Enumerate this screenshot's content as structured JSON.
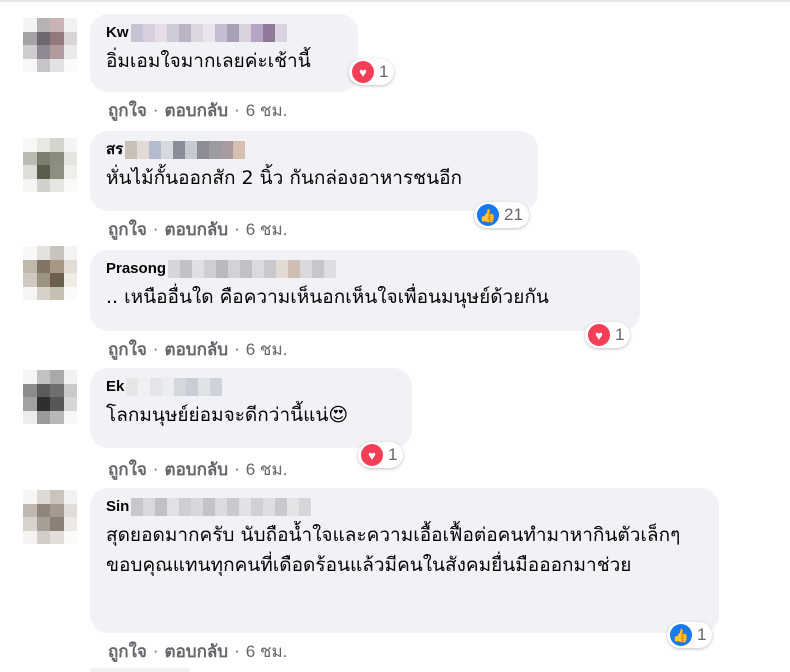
{
  "comments": [
    {
      "name": "Kw",
      "text": "อิ่มเอมใจมากเลยค่ะเช้านี้",
      "reaction": {
        "type": "heart",
        "count": "1"
      },
      "like_label": "ถูกใจ",
      "reply_label": "ตอบกลับ",
      "time": "6 ชม."
    },
    {
      "name": "สร",
      "text": "หั่นไม้กั้นออกสัก 2 นิ้ว กันกล่องอาหารชนอีก",
      "reaction": {
        "type": "like",
        "count": "21"
      },
      "like_label": "ถูกใจ",
      "reply_label": "ตอบกลับ",
      "time": "6 ชม."
    },
    {
      "name": "Prasong",
      "text": ".. เหนืออื่นใด คือความเห็นอกเห็นใจเพื่อนมนุษย์ด้วยกัน",
      "reaction": {
        "type": "heart",
        "count": "1"
      },
      "like_label": "ถูกใจ",
      "reply_label": "ตอบกลับ",
      "time": "6 ชม."
    },
    {
      "name": "Ek",
      "text": "โลกมนุษย์ย่อมจะดีกว่านี้แน่😍",
      "reaction": {
        "type": "heart",
        "count": "1"
      },
      "like_label": "ถูกใจ",
      "reply_label": "ตอบกลับ",
      "time": "6 ชม."
    },
    {
      "name": "Sin",
      "text": "สุดยอดมากครับ นับถือน้ำใจและความเอื้อเฟื้อต่อคนทำมาหากินตัวเล็กๆ ขอบคุณแทนทุกคนที่เดือดร้อนแล้วมีคนในสังคมยื่นมือออกมาช่วย",
      "reaction": {
        "type": "like",
        "count": "1"
      },
      "like_label": "ถูกใจ",
      "reply_label": "ตอบกลับ",
      "time": "6 ชม."
    }
  ],
  "icons": {
    "heart": "heart-icon",
    "like": "thumbs-up-icon"
  },
  "colors": {
    "heart": "#f33e58",
    "like": "#1877f2",
    "bubble": "#f0f2f5",
    "meta": "#65676b"
  }
}
